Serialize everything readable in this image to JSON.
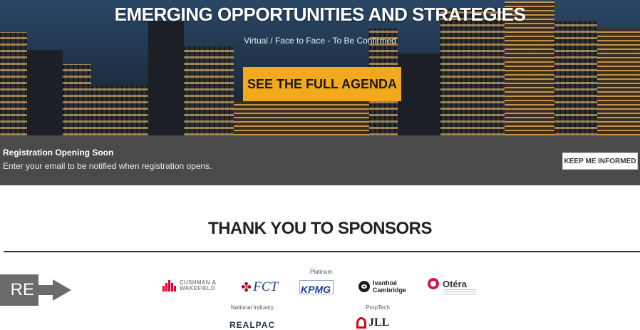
{
  "hero": {
    "title": "EMERGING OPPORTUNITIES AND STRATEGIES",
    "subtitle": "Virtual / Face to Face - To Be Confirmed",
    "cta_label": "SEE THE FULL AGENDA",
    "accent_color": "#f2a91d"
  },
  "registration": {
    "title": "Registration Opening Soon",
    "text": "Enter your email to be notified when registration opens.",
    "button_label": "KEEP ME INFORMED"
  },
  "sponsors": {
    "heading": "THANK YOU TO SPONSORS",
    "tiers": {
      "platinum": "Platinum",
      "national_industry": "National Industry",
      "proptech": "PropTech"
    },
    "logos": {
      "cushman_line1": "CUSHMAN &",
      "cushman_line2": "WAKEFIELD",
      "fct": "FCT",
      "kpmg": "KPMG",
      "ivanhoe_line1": "Ivanhoé",
      "ivanhoe_line2": "Cambridge",
      "otera": "Otéra",
      "realpac": "REALPAC",
      "jll": "JLL"
    }
  },
  "overlay": {
    "arrow_text": "RE"
  }
}
